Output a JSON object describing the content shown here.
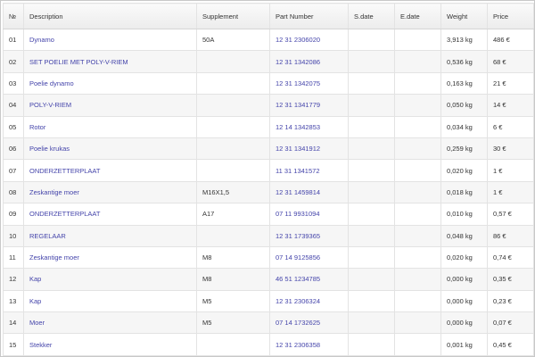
{
  "table": {
    "headers": {
      "num": "№",
      "description": "Description",
      "supplement": "Supplement",
      "part_number": "Part Number",
      "s_date": "S.date",
      "e_date": "E.date",
      "weight": "Weight",
      "price": "Price"
    },
    "rows": [
      {
        "num": "01",
        "description": "Dynamo",
        "supplement": "50A",
        "part_number": "12 31 2306020",
        "s_date": "",
        "e_date": "",
        "weight": "3,913 kg",
        "price": "486 €"
      },
      {
        "num": "02",
        "description": "SET POELIE MET POLY-V-RIEM",
        "supplement": "",
        "part_number": "12 31 1342086",
        "s_date": "",
        "e_date": "",
        "weight": "0,536 kg",
        "price": "68 €"
      },
      {
        "num": "03",
        "description": "Poelie dynamo",
        "supplement": "",
        "part_number": "12 31 1342075",
        "s_date": "",
        "e_date": "",
        "weight": "0,163 kg",
        "price": "21 €"
      },
      {
        "num": "04",
        "description": "POLY-V-RIEM",
        "supplement": "",
        "part_number": "12 31 1341779",
        "s_date": "",
        "e_date": "",
        "weight": "0,050 kg",
        "price": "14 €"
      },
      {
        "num": "05",
        "description": "Rotor",
        "supplement": "",
        "part_number": "12 14 1342853",
        "s_date": "",
        "e_date": "",
        "weight": "0,034 kg",
        "price": "6 €"
      },
      {
        "num": "06",
        "description": "Poelie krukas",
        "supplement": "",
        "part_number": "12 31 1341912",
        "s_date": "",
        "e_date": "",
        "weight": "0,259 kg",
        "price": "30 €"
      },
      {
        "num": "07",
        "description": "ONDERZETTERPLAAT",
        "supplement": "",
        "part_number": "11 31 1341572",
        "s_date": "",
        "e_date": "",
        "weight": "0,020 kg",
        "price": "1 €"
      },
      {
        "num": "08",
        "description": "Zeskantige moer",
        "supplement": "M16X1,5",
        "part_number": "12 31 1459814",
        "s_date": "",
        "e_date": "",
        "weight": "0,018 kg",
        "price": "1 €"
      },
      {
        "num": "09",
        "description": "ONDERZETTERPLAAT",
        "supplement": "A17",
        "part_number": "07 11 9931094",
        "s_date": "",
        "e_date": "",
        "weight": "0,010 kg",
        "price": "0,57 €"
      },
      {
        "num": "10",
        "description": "REGELAAR",
        "supplement": "",
        "part_number": "12 31 1739365",
        "s_date": "",
        "e_date": "",
        "weight": "0,048 kg",
        "price": "86 €"
      },
      {
        "num": "11",
        "description": "Zeskantige moer",
        "supplement": "M8",
        "part_number": "07 14 9125856",
        "s_date": "",
        "e_date": "",
        "weight": "0,020 kg",
        "price": "0,74 €"
      },
      {
        "num": "12",
        "description": "Kap",
        "supplement": "M8",
        "part_number": "46 51 1234785",
        "s_date": "",
        "e_date": "",
        "weight": "0,000 kg",
        "price": "0,35 €"
      },
      {
        "num": "13",
        "description": "Kap",
        "supplement": "M5",
        "part_number": "12 31 2306324",
        "s_date": "",
        "e_date": "",
        "weight": "0,000 kg",
        "price": "0,23 €"
      },
      {
        "num": "14",
        "description": "Moer",
        "supplement": "M5",
        "part_number": "07 14 1732625",
        "s_date": "",
        "e_date": "",
        "weight": "0,000 kg",
        "price": "0,07 €"
      },
      {
        "num": "15",
        "description": "Stekker",
        "supplement": "",
        "part_number": "12 31 2306358",
        "s_date": "",
        "e_date": "",
        "weight": "0,001 kg",
        "price": "0,45 €"
      }
    ]
  },
  "colors": {
    "link": "#4444aa",
    "text": "#333333",
    "border": "#e3e3e3",
    "row_alt": "#f6f6f6"
  }
}
